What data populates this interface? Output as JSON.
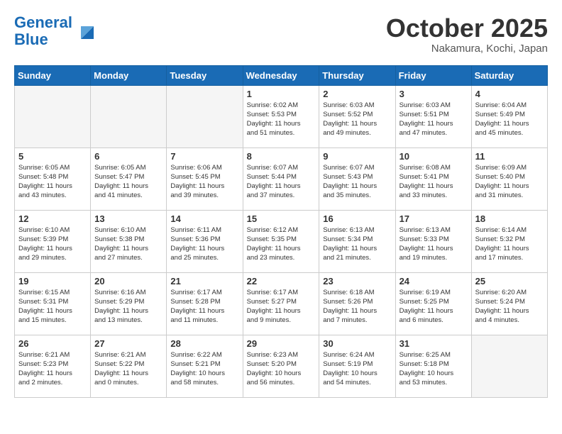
{
  "header": {
    "logo_line1": "General",
    "logo_line2": "Blue",
    "month": "October 2025",
    "location": "Nakamura, Kochi, Japan"
  },
  "weekdays": [
    "Sunday",
    "Monday",
    "Tuesday",
    "Wednesday",
    "Thursday",
    "Friday",
    "Saturday"
  ],
  "weeks": [
    [
      {
        "day": "",
        "info": "",
        "empty": true
      },
      {
        "day": "",
        "info": "",
        "empty": true
      },
      {
        "day": "",
        "info": "",
        "empty": true
      },
      {
        "day": "1",
        "info": "Sunrise: 6:02 AM\nSunset: 5:53 PM\nDaylight: 11 hours\nand 51 minutes."
      },
      {
        "day": "2",
        "info": "Sunrise: 6:03 AM\nSunset: 5:52 PM\nDaylight: 11 hours\nand 49 minutes."
      },
      {
        "day": "3",
        "info": "Sunrise: 6:03 AM\nSunset: 5:51 PM\nDaylight: 11 hours\nand 47 minutes."
      },
      {
        "day": "4",
        "info": "Sunrise: 6:04 AM\nSunset: 5:49 PM\nDaylight: 11 hours\nand 45 minutes."
      }
    ],
    [
      {
        "day": "5",
        "info": "Sunrise: 6:05 AM\nSunset: 5:48 PM\nDaylight: 11 hours\nand 43 minutes."
      },
      {
        "day": "6",
        "info": "Sunrise: 6:05 AM\nSunset: 5:47 PM\nDaylight: 11 hours\nand 41 minutes."
      },
      {
        "day": "7",
        "info": "Sunrise: 6:06 AM\nSunset: 5:45 PM\nDaylight: 11 hours\nand 39 minutes."
      },
      {
        "day": "8",
        "info": "Sunrise: 6:07 AM\nSunset: 5:44 PM\nDaylight: 11 hours\nand 37 minutes."
      },
      {
        "day": "9",
        "info": "Sunrise: 6:07 AM\nSunset: 5:43 PM\nDaylight: 11 hours\nand 35 minutes."
      },
      {
        "day": "10",
        "info": "Sunrise: 6:08 AM\nSunset: 5:41 PM\nDaylight: 11 hours\nand 33 minutes."
      },
      {
        "day": "11",
        "info": "Sunrise: 6:09 AM\nSunset: 5:40 PM\nDaylight: 11 hours\nand 31 minutes."
      }
    ],
    [
      {
        "day": "12",
        "info": "Sunrise: 6:10 AM\nSunset: 5:39 PM\nDaylight: 11 hours\nand 29 minutes."
      },
      {
        "day": "13",
        "info": "Sunrise: 6:10 AM\nSunset: 5:38 PM\nDaylight: 11 hours\nand 27 minutes."
      },
      {
        "day": "14",
        "info": "Sunrise: 6:11 AM\nSunset: 5:36 PM\nDaylight: 11 hours\nand 25 minutes."
      },
      {
        "day": "15",
        "info": "Sunrise: 6:12 AM\nSunset: 5:35 PM\nDaylight: 11 hours\nand 23 minutes."
      },
      {
        "day": "16",
        "info": "Sunrise: 6:13 AM\nSunset: 5:34 PM\nDaylight: 11 hours\nand 21 minutes."
      },
      {
        "day": "17",
        "info": "Sunrise: 6:13 AM\nSunset: 5:33 PM\nDaylight: 11 hours\nand 19 minutes."
      },
      {
        "day": "18",
        "info": "Sunrise: 6:14 AM\nSunset: 5:32 PM\nDaylight: 11 hours\nand 17 minutes."
      }
    ],
    [
      {
        "day": "19",
        "info": "Sunrise: 6:15 AM\nSunset: 5:31 PM\nDaylight: 11 hours\nand 15 minutes."
      },
      {
        "day": "20",
        "info": "Sunrise: 6:16 AM\nSunset: 5:29 PM\nDaylight: 11 hours\nand 13 minutes."
      },
      {
        "day": "21",
        "info": "Sunrise: 6:17 AM\nSunset: 5:28 PM\nDaylight: 11 hours\nand 11 minutes."
      },
      {
        "day": "22",
        "info": "Sunrise: 6:17 AM\nSunset: 5:27 PM\nDaylight: 11 hours\nand 9 minutes."
      },
      {
        "day": "23",
        "info": "Sunrise: 6:18 AM\nSunset: 5:26 PM\nDaylight: 11 hours\nand 7 minutes."
      },
      {
        "day": "24",
        "info": "Sunrise: 6:19 AM\nSunset: 5:25 PM\nDaylight: 11 hours\nand 6 minutes."
      },
      {
        "day": "25",
        "info": "Sunrise: 6:20 AM\nSunset: 5:24 PM\nDaylight: 11 hours\nand 4 minutes."
      }
    ],
    [
      {
        "day": "26",
        "info": "Sunrise: 6:21 AM\nSunset: 5:23 PM\nDaylight: 11 hours\nand 2 minutes."
      },
      {
        "day": "27",
        "info": "Sunrise: 6:21 AM\nSunset: 5:22 PM\nDaylight: 11 hours\nand 0 minutes."
      },
      {
        "day": "28",
        "info": "Sunrise: 6:22 AM\nSunset: 5:21 PM\nDaylight: 10 hours\nand 58 minutes."
      },
      {
        "day": "29",
        "info": "Sunrise: 6:23 AM\nSunset: 5:20 PM\nDaylight: 10 hours\nand 56 minutes."
      },
      {
        "day": "30",
        "info": "Sunrise: 6:24 AM\nSunset: 5:19 PM\nDaylight: 10 hours\nand 54 minutes."
      },
      {
        "day": "31",
        "info": "Sunrise: 6:25 AM\nSunset: 5:18 PM\nDaylight: 10 hours\nand 53 minutes."
      },
      {
        "day": "",
        "info": "",
        "empty": true
      }
    ]
  ]
}
